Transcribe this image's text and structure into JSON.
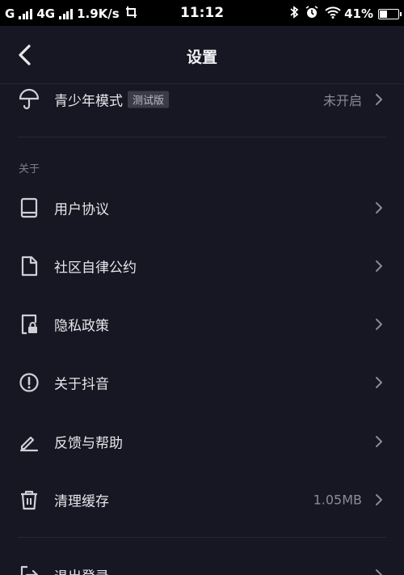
{
  "status_bar": {
    "carrier1": "G",
    "carrier2": "4G",
    "speed": "1.9K/s",
    "time": "11:12",
    "battery": "41%",
    "battery_level": 0.41
  },
  "header": {
    "title": "设置"
  },
  "youth_mode": {
    "label": "青少年模式",
    "tag": "测试版",
    "value": "未开启"
  },
  "about_section": {
    "title": "关于",
    "items": [
      {
        "label": "用户协议",
        "value": ""
      },
      {
        "label": "社区自律公约",
        "value": ""
      },
      {
        "label": "隐私政策",
        "value": ""
      },
      {
        "label": "关于抖音",
        "value": ""
      },
      {
        "label": "反馈与帮助",
        "value": ""
      },
      {
        "label": "清理缓存",
        "value": "1.05MB"
      }
    ]
  },
  "logout": {
    "label": "退出登录"
  },
  "colors": {
    "background": "#161722",
    "text": "#e6e6ea",
    "secondary": "#8a8b94"
  }
}
